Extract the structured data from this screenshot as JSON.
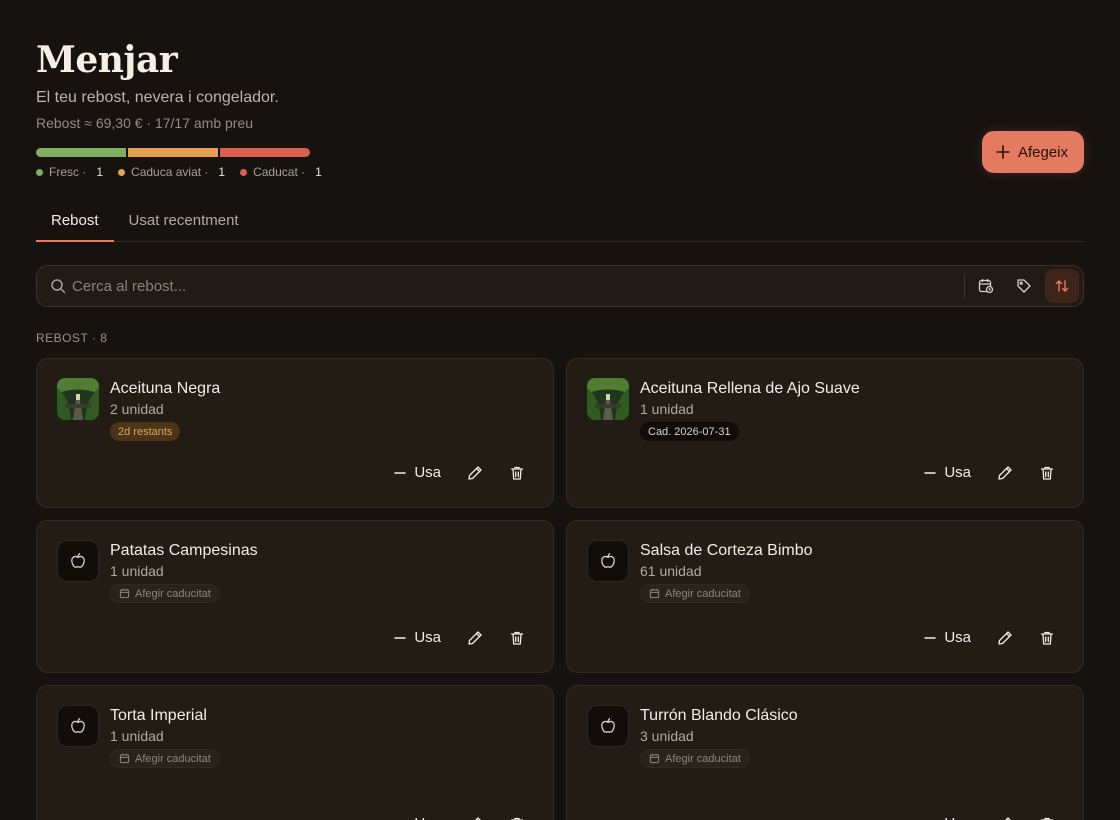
{
  "header": {
    "title": "Menjar",
    "subtitle": "El teu rebost, nevera i congelador.",
    "stats": "Rebost ≈ 69,30 € · 17/17 amb preu",
    "add_label": "Afegeix"
  },
  "freshness": {
    "colors": {
      "fresc": "#7fae63",
      "aviat": "#e6a04f",
      "caducat": "#d9604f"
    },
    "legend": [
      {
        "label": "Fresc ·",
        "count": "1"
      },
      {
        "label": "Caduca aviat ·",
        "count": "1"
      },
      {
        "label": "Caducat ·",
        "count": "1"
      }
    ]
  },
  "tabs": [
    {
      "label": "Rebost",
      "active": true
    },
    {
      "label": "Usat recentment",
      "active": false
    }
  ],
  "search": {
    "placeholder": "Cerca al rebost...",
    "value": ""
  },
  "toolbar_icons": [
    "calendar-clock-icon",
    "tag-icon",
    "sort-icon"
  ],
  "section": {
    "label": "REBOST · 8"
  },
  "items": [
    {
      "name": "Aceituna Negra",
      "qty": "2 unidad",
      "chip": "2d restants",
      "chip_type": "warn",
      "thumb": "photo"
    },
    {
      "name": "Aceituna Rellena de Ajo Suave",
      "qty": "1 unidad",
      "chip": "Cad. 2026-07-31",
      "chip_type": "date",
      "thumb": "photo"
    },
    {
      "name": "Patatas Campesinas",
      "qty": "1 unidad",
      "chip": "Afegir caducitat",
      "chip_type": "add",
      "thumb": "apple"
    },
    {
      "name": "Salsa de Corteza Bimbo",
      "qty": "61 unidad",
      "chip": "Afegir caducitat",
      "chip_type": "add",
      "thumb": "apple"
    },
    {
      "name": "Torta Imperial",
      "qty": "1 unidad",
      "chip": "Afegir caducitat",
      "chip_type": "add",
      "thumb": "apple"
    },
    {
      "name": "Turrón Blando Clásico",
      "qty": "3 unidad",
      "chip": "Afegir caducitat",
      "chip_type": "add",
      "thumb": "apple"
    }
  ],
  "actions": {
    "use_label": "Usa"
  },
  "colors": {
    "accent": "#e47a5f",
    "background": "#16120f",
    "card": "#221c15"
  }
}
